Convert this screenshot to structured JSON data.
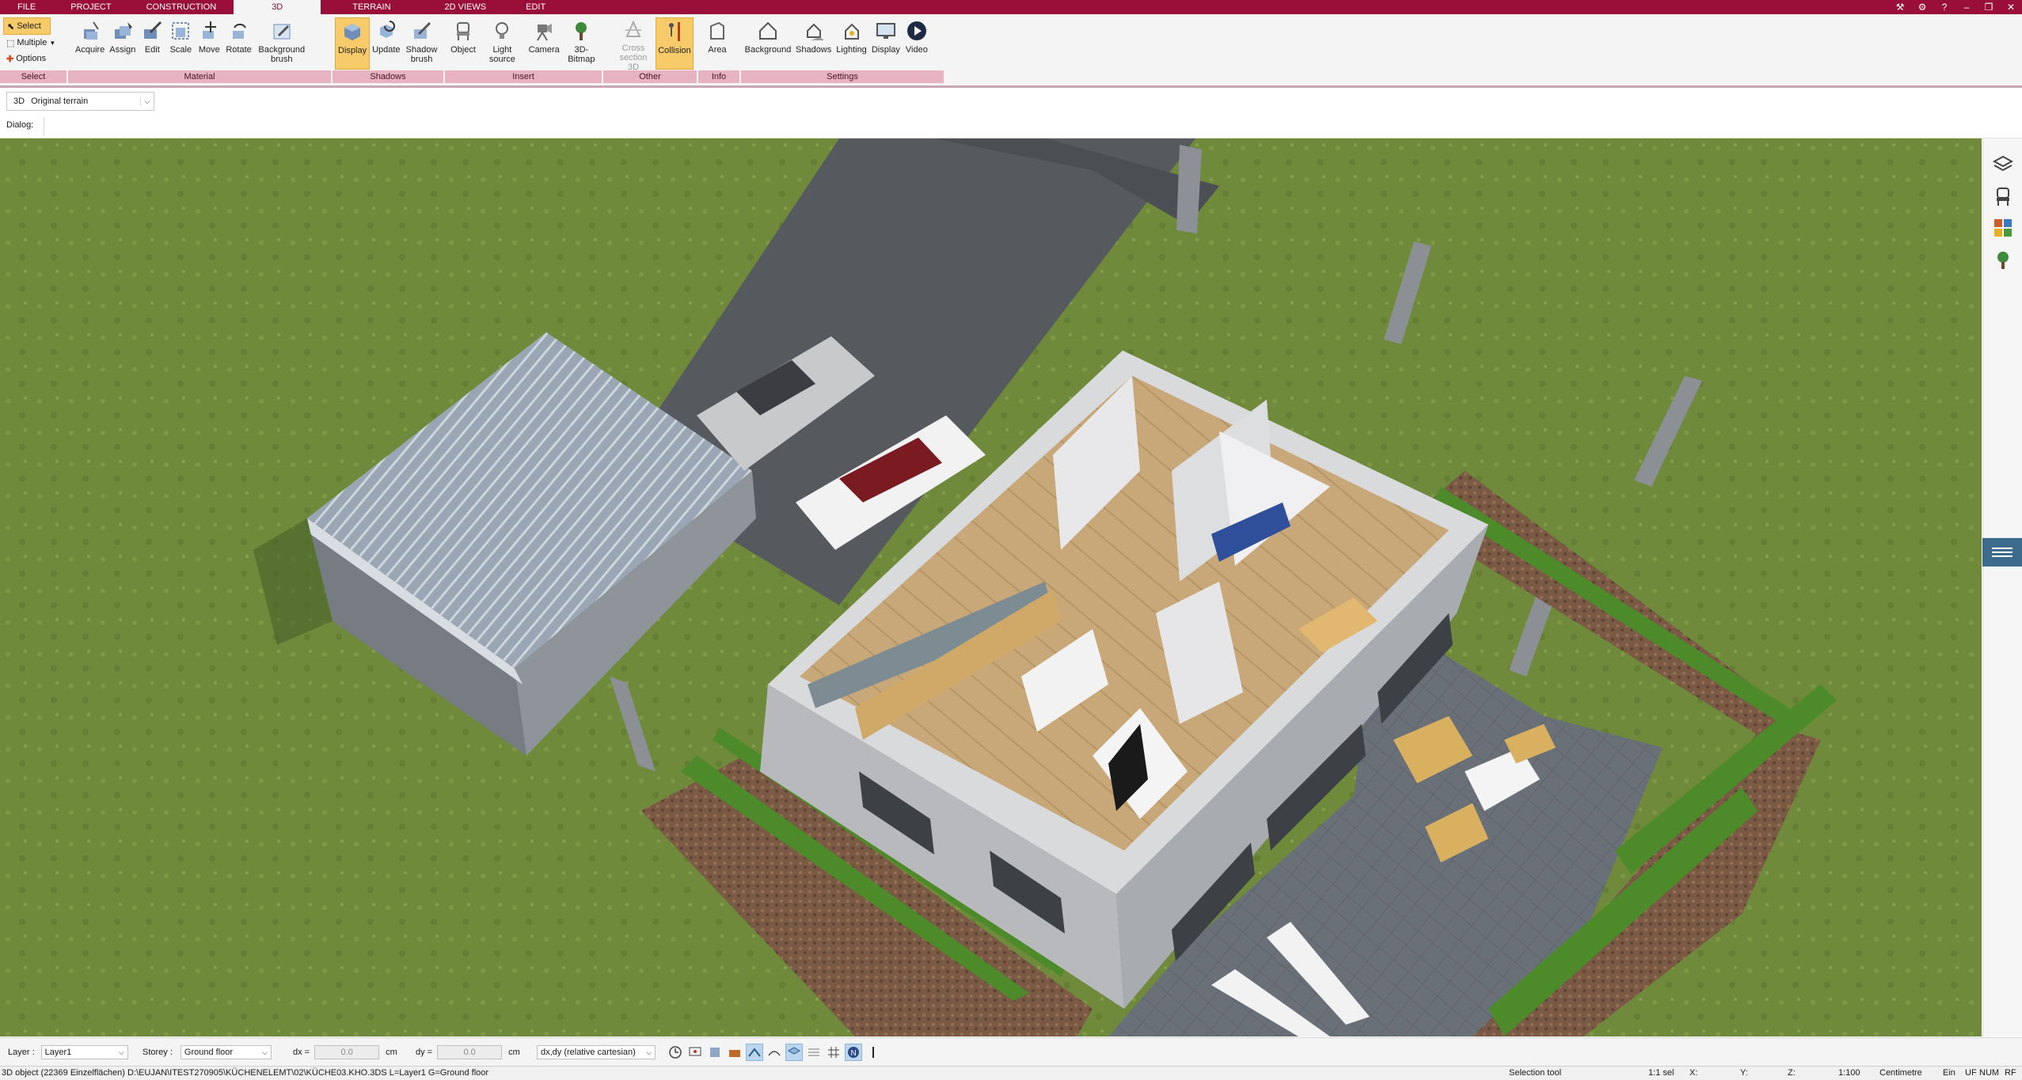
{
  "menu": {
    "tabs": [
      "FILE",
      "PROJECT",
      "CONSTRUCTION",
      "3D",
      "TERRAIN",
      "2D VIEWS",
      "EDIT"
    ],
    "active_index": 3
  },
  "ribbon": {
    "select_group": {
      "select": "Select",
      "multiple": "Multiple",
      "options": "Options",
      "label": "Select"
    },
    "material_group": {
      "label": "Material",
      "buttons": [
        "Acquire",
        "Assign",
        "Edit",
        "Scale",
        "Move",
        "Rotate",
        "Background brush"
      ]
    },
    "shadows_group": {
      "label": "Shadows",
      "buttons": [
        "Display",
        "Update",
        "Shadow brush"
      ]
    },
    "insert_group": {
      "label": "Insert",
      "buttons": [
        "Object",
        "Light source",
        "Camera",
        "3D-Bitmap"
      ]
    },
    "other_group": {
      "label": "Other",
      "buttons": [
        "Cross section 3D",
        "Collision"
      ]
    },
    "info_group": {
      "label": "Info",
      "buttons": [
        "Area"
      ]
    },
    "settings_group": {
      "label": "Settings",
      "buttons": [
        "Background",
        "Shadows",
        "Lighting",
        "Display",
        "Video"
      ]
    }
  },
  "view": {
    "mode": "3D",
    "terrain": "Original terrain"
  },
  "dialog": {
    "label": "Dialog:"
  },
  "inputbar": {
    "layer_label": "Layer :",
    "layer_value": "Layer1",
    "storey_label": "Storey :",
    "storey_value": "Ground floor",
    "dx_label": "dx =",
    "dx_value": "0.0",
    "dx_unit": "cm",
    "dy_label": "dy =",
    "dy_value": "0.0",
    "dy_unit": "cm",
    "coord_mode": "dx,dy (relative cartesian)"
  },
  "statusbar": {
    "object_info": "3D object (22369 Einzelflächen) D:\\EUJAN\\ITEST270905\\KÜCHENELEMT\\02\\KÜCHE03.KHO.3DS L=Layer1 G=Ground floor",
    "tool": "Selection tool",
    "selection": "1:1 sel",
    "x": "X:",
    "y": "Y:",
    "z": "Z:",
    "scale": "1:100",
    "unit": "Centimetre",
    "ein": "Ein",
    "uf": "UF",
    "num": "NUM",
    "rf": "RF"
  },
  "colors": {
    "accent": "#9a0f3a",
    "group_label_bg": "#e7b3c3",
    "active_button": "#f7cb6a",
    "lawn": "#6f8b3a"
  }
}
